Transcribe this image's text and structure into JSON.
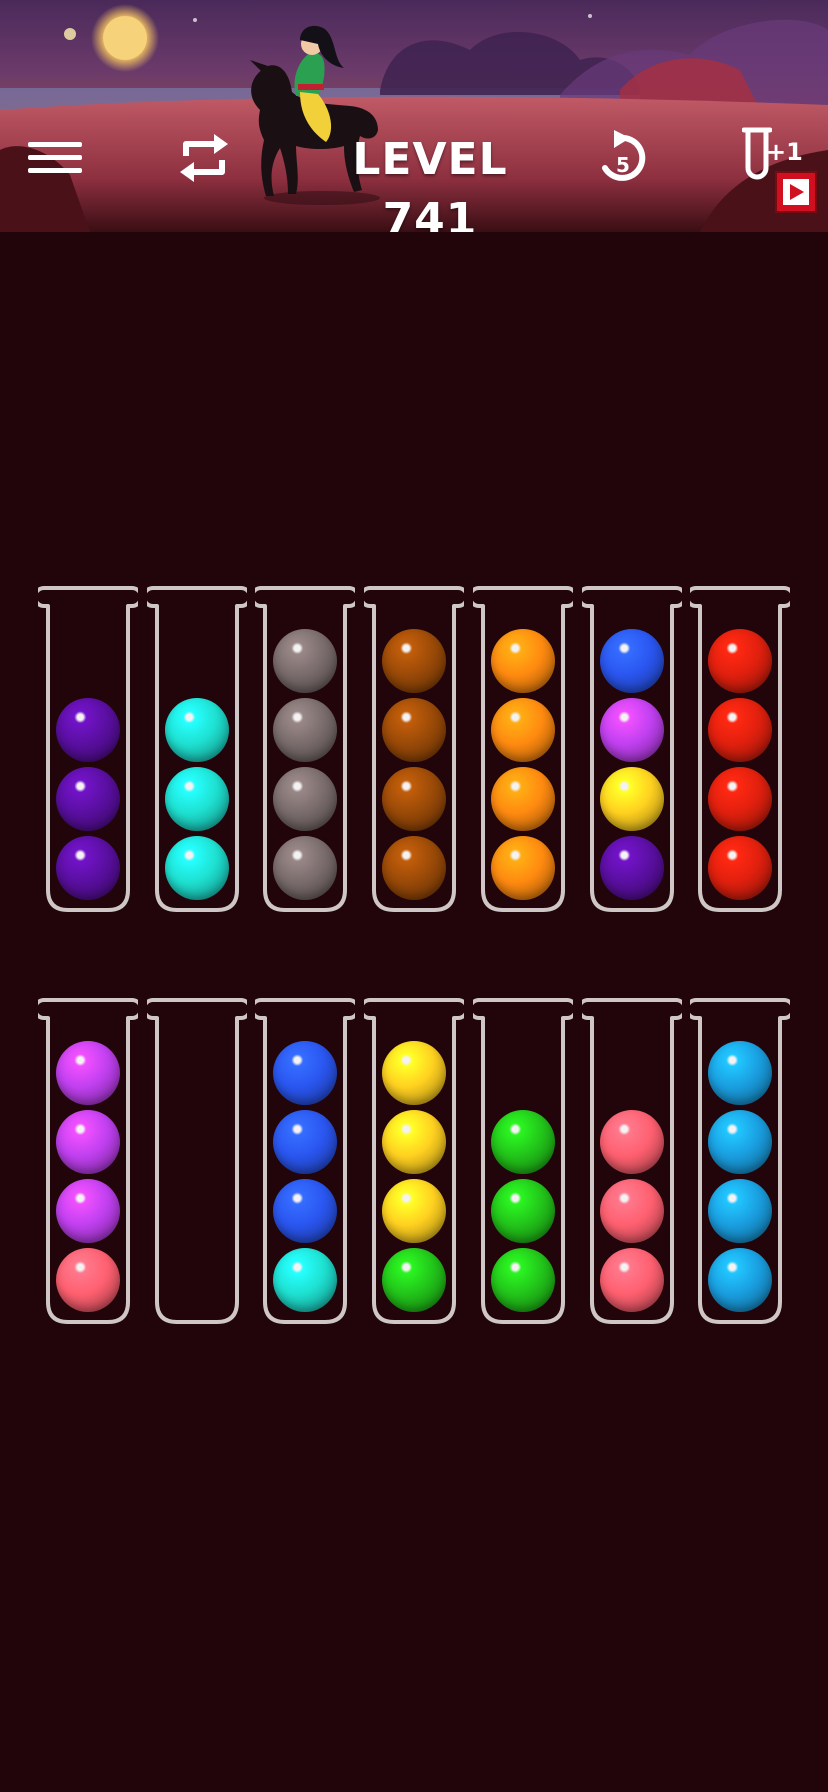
{
  "header": {
    "level_label": "LEVEL 741",
    "undo_count": "5",
    "add_tube_label": "+1",
    "icons": {
      "menu": "hamburger-menu-icon",
      "restart": "restart-arrows-icon",
      "undo": "undo-arrow-icon",
      "add_tube": "test-tube-icon",
      "video_ad": "play-video-icon"
    }
  },
  "ball_colors": {
    "purple": "#5a0fa0",
    "teal": "#1ee0d0",
    "gray": "#7a6c6c",
    "brown": "#9a4a08",
    "orange": "#ff8a10",
    "blue": "#2a56f0",
    "magenta": "#c040f0",
    "yellow": "#ffd020",
    "red": "#e0200e",
    "pink": "#ff6070",
    "green": "#22c41a",
    "sky": "#1a9ee0"
  },
  "tubes": [
    {
      "row": 1,
      "col": 1,
      "balls": [
        "purple",
        "purple",
        "purple"
      ]
    },
    {
      "row": 1,
      "col": 2,
      "balls": [
        "teal",
        "teal",
        "teal"
      ]
    },
    {
      "row": 1,
      "col": 3,
      "balls": [
        "gray",
        "gray",
        "gray",
        "gray"
      ]
    },
    {
      "row": 1,
      "col": 4,
      "balls": [
        "brown",
        "brown",
        "brown",
        "brown"
      ]
    },
    {
      "row": 1,
      "col": 5,
      "balls": [
        "orange",
        "orange",
        "orange",
        "orange"
      ]
    },
    {
      "row": 1,
      "col": 6,
      "balls": [
        "purple",
        "yellow",
        "magenta",
        "blue"
      ]
    },
    {
      "row": 1,
      "col": 7,
      "balls": [
        "red",
        "red",
        "red",
        "red"
      ]
    },
    {
      "row": 2,
      "col": 1,
      "balls": [
        "pink",
        "magenta",
        "magenta",
        "magenta"
      ]
    },
    {
      "row": 2,
      "col": 2,
      "balls": []
    },
    {
      "row": 2,
      "col": 3,
      "balls": [
        "teal",
        "blue",
        "blue",
        "blue"
      ]
    },
    {
      "row": 2,
      "col": 4,
      "balls": [
        "green",
        "yellow",
        "yellow",
        "yellow"
      ]
    },
    {
      "row": 2,
      "col": 5,
      "balls": [
        "green",
        "green",
        "green"
      ]
    },
    {
      "row": 2,
      "col": 6,
      "balls": [
        "pink",
        "pink",
        "pink"
      ]
    },
    {
      "row": 2,
      "col": 7,
      "balls": [
        "sky",
        "sky",
        "sky",
        "sky"
      ]
    }
  ]
}
